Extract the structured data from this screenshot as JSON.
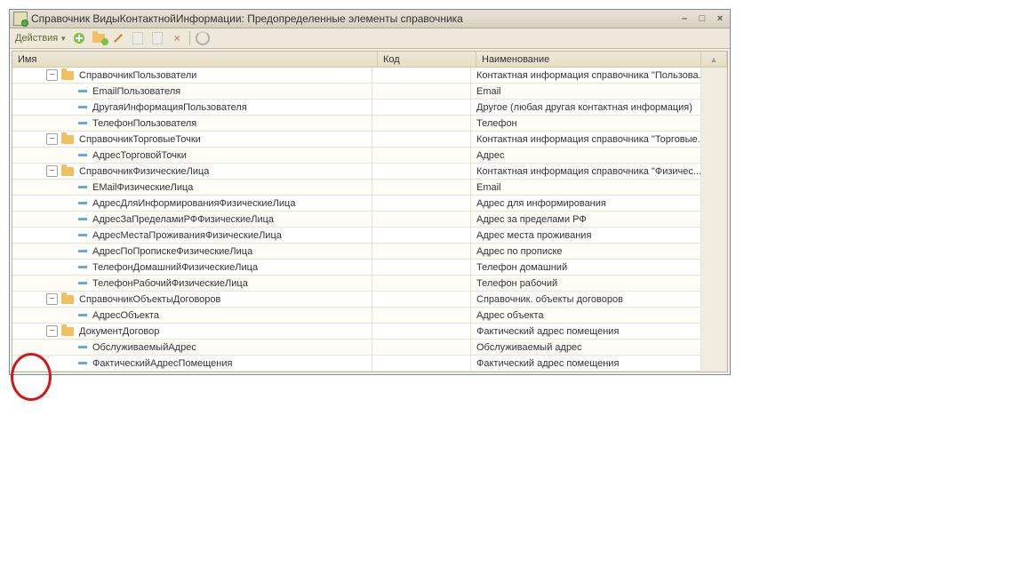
{
  "window": {
    "title": "Справочник ВидыКонтактнойИнформации: Предопределенные элементы справочника"
  },
  "toolbar": {
    "actions_label": "Действия"
  },
  "columns": {
    "name": "Имя",
    "code": "Код",
    "desc": "Наименование"
  },
  "rows": [
    {
      "level": 0,
      "type": "folder",
      "exp": true,
      "name": "СправочникПользователи",
      "code": "",
      "desc": "Контактная информация справочника \"Пользова..."
    },
    {
      "level": 1,
      "type": "item",
      "name": "EmailПользователя",
      "code": "",
      "desc": "Email"
    },
    {
      "level": 1,
      "type": "item",
      "name": "ДругаяИнформацияПользователя",
      "code": "",
      "desc": "Другое (любая другая контактная информация)"
    },
    {
      "level": 1,
      "type": "item",
      "name": "ТелефонПользователя",
      "code": "",
      "desc": "Телефон"
    },
    {
      "level": 0,
      "type": "folder",
      "exp": true,
      "name": "СправочникТорговыеТочки",
      "code": "",
      "desc": "Контактная информация справочника \"Торговые..."
    },
    {
      "level": 1,
      "type": "item",
      "name": "АдресТорговойТочки",
      "code": "",
      "desc": "Адрес"
    },
    {
      "level": 0,
      "type": "folder",
      "exp": true,
      "name": "СправочникФизическиеЛица",
      "code": "",
      "desc": "Контактная информация справочника \"Физичес..."
    },
    {
      "level": 1,
      "type": "item",
      "name": "EMailФизическиеЛица",
      "code": "",
      "desc": "Email"
    },
    {
      "level": 1,
      "type": "item",
      "name": "АдресДляИнформированияФизическиеЛица",
      "code": "",
      "desc": "Адрес для информирования"
    },
    {
      "level": 1,
      "type": "item",
      "name": "АдресЗаПределамиРФФизическиеЛица",
      "code": "",
      "desc": "Адрес за пределами РФ"
    },
    {
      "level": 1,
      "type": "item",
      "name": "АдресМестаПроживанияФизическиеЛица",
      "code": "",
      "desc": "Адрес места проживания"
    },
    {
      "level": 1,
      "type": "item",
      "name": "АдресПоПропискеФизическиеЛица",
      "code": "",
      "desc": "Адрес по прописке"
    },
    {
      "level": 1,
      "type": "item",
      "name": "ТелефонДомашнийФизическиеЛица",
      "code": "",
      "desc": "Телефон домашний"
    },
    {
      "level": 1,
      "type": "item",
      "name": "ТелефонРабочийФизическиеЛица",
      "code": "",
      "desc": "Телефон рабочий"
    },
    {
      "level": 0,
      "type": "folder",
      "exp": true,
      "name": "СправочникОбъектыДоговоров",
      "code": "",
      "desc": "Справочник. объекты договоров"
    },
    {
      "level": 1,
      "type": "item",
      "name": "АдресОбъекта",
      "code": "",
      "desc": "Адрес объекта"
    },
    {
      "level": 0,
      "type": "folder",
      "exp": true,
      "name": "ДокументДоговор",
      "code": "",
      "desc": "Фактический адрес помещения"
    },
    {
      "level": 1,
      "type": "item",
      "name": "ОбслуживаемыйАдрес",
      "code": "",
      "desc": "Обслуживаемый адрес"
    },
    {
      "level": 1,
      "type": "item",
      "name": "ФактическийАдресПомещения",
      "code": "",
      "desc": "Фактический адрес помещения"
    }
  ]
}
